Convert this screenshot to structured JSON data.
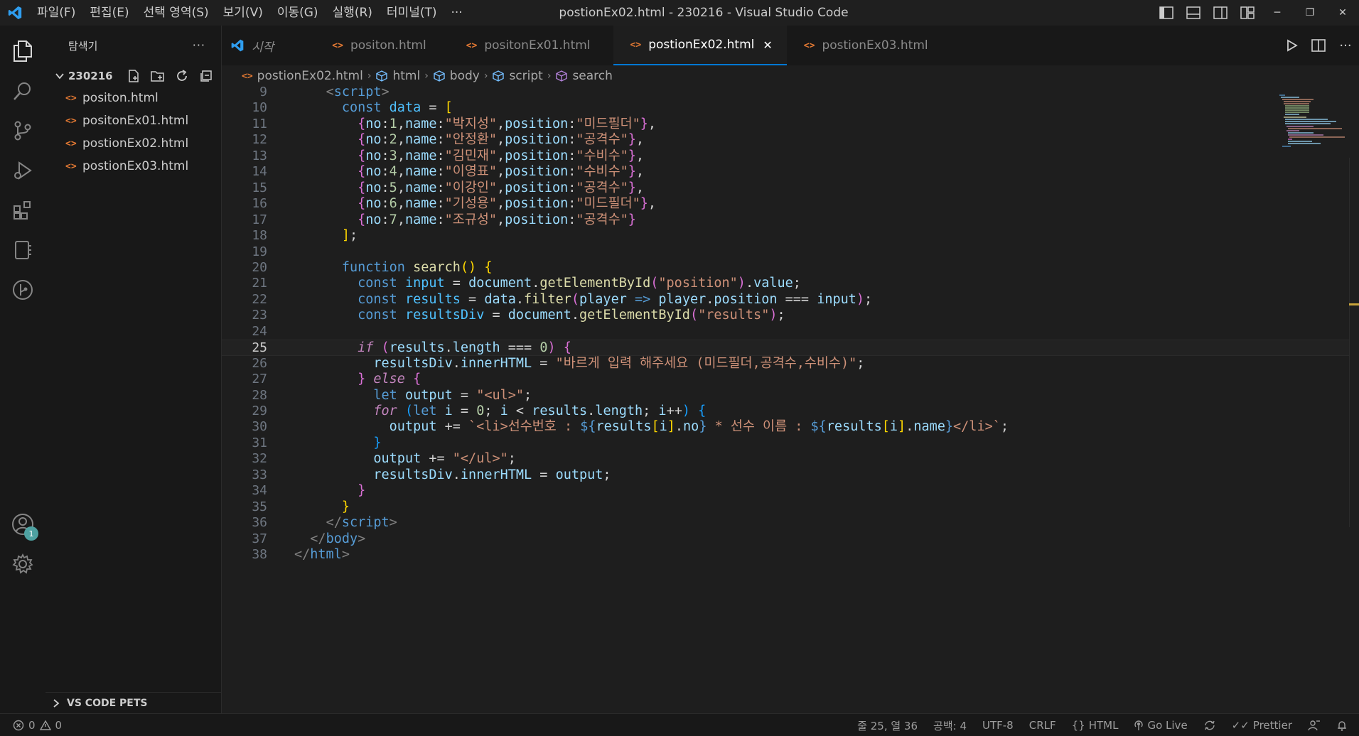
{
  "titlebar": {
    "menu": [
      "파일(F)",
      "편집(E)",
      "선택 영역(S)",
      "보기(V)",
      "이동(G)",
      "실행(R)",
      "터미널(T)",
      "···"
    ],
    "window_title": "postionEx02.html - 230216 - Visual Studio Code"
  },
  "sidebar": {
    "title": "탐색기",
    "more": "···",
    "folder": "230216",
    "files": [
      "positon.html",
      "positonEx01.html",
      "postionEx02.html",
      "postionEx03.html"
    ],
    "pets_section": "VS CODE PETS",
    "account_badge": "1"
  },
  "tabs": [
    {
      "label": "시작",
      "kind": "welcome"
    },
    {
      "label": "positon.html"
    },
    {
      "label": "positonEx01.html"
    },
    {
      "label": "postionEx02.html",
      "active": true
    },
    {
      "label": "postionEx03.html"
    }
  ],
  "breadcrumb": [
    "postionEx02.html",
    "html",
    "body",
    "script",
    "search"
  ],
  "editor": {
    "current_line": 25,
    "line_numbers": [
      "9",
      "10",
      "11",
      "12",
      "13",
      "14",
      "15",
      "16",
      "17",
      "18",
      "19",
      "20",
      "21",
      "22",
      "23",
      "24",
      "25",
      "26",
      "27",
      "28",
      "29",
      "30",
      "31",
      "32",
      "33",
      "34",
      "35",
      "36",
      "37",
      "38"
    ]
  },
  "statusbar": {
    "errors": "0",
    "warnings": "0",
    "position": "줄 25, 열 36",
    "spaces": "공백: 4",
    "encoding": "UTF-8",
    "eol": "CRLF",
    "language": "HTML",
    "golive": "Go Live",
    "prettier": "Prettier"
  }
}
